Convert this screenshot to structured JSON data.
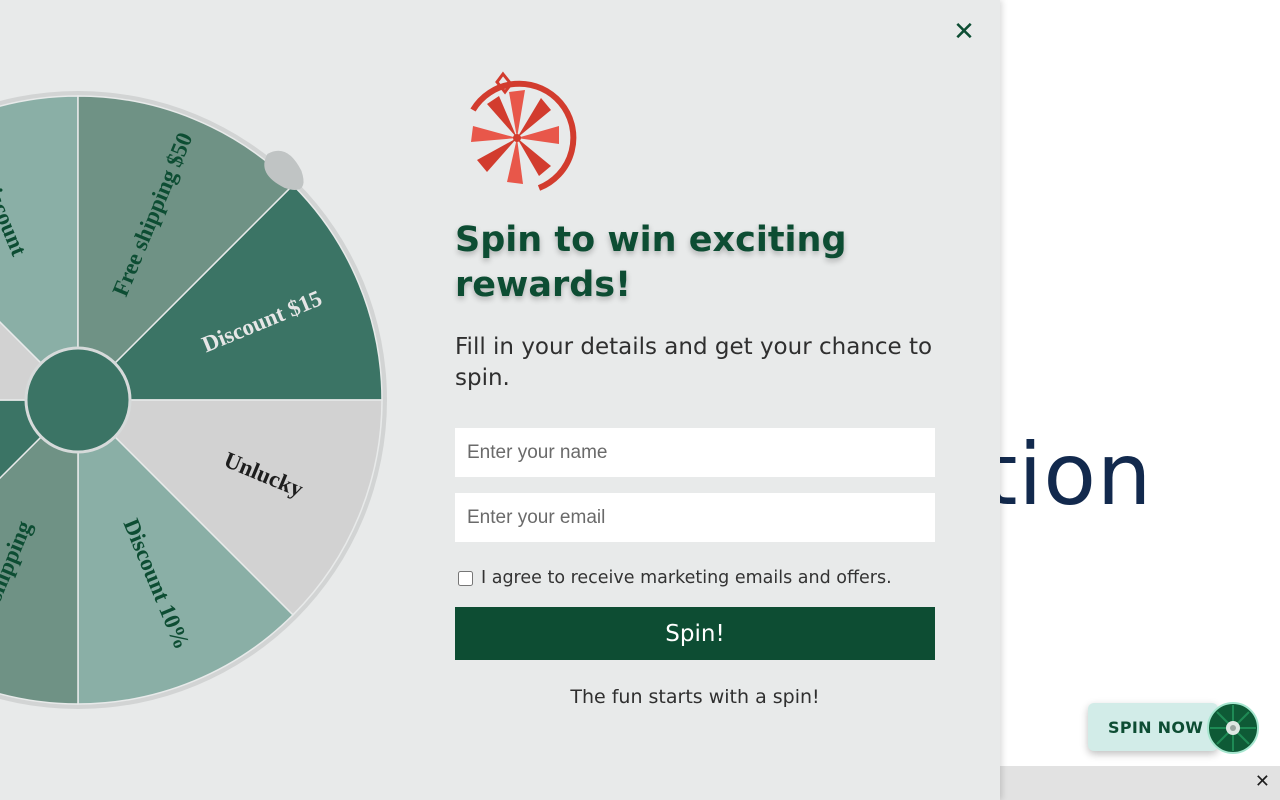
{
  "background": {
    "heading_fragment": "ation"
  },
  "popup": {
    "close_icon": "close-icon",
    "title": "Spin to win exciting rewards!",
    "subtitle": "Fill in your details and get your chance to spin.",
    "name_placeholder": "Enter your name",
    "email_placeholder": "Enter your email",
    "consent_label": "I agree to receive marketing emails and offers.",
    "consent_checked": false,
    "spin_button": "Spin!",
    "footer": "The fun starts with a spin!",
    "colors": {
      "brand_green": "#0d4d33",
      "logo_red": "#d23c2e",
      "panel_bg": "#e8eaea"
    }
  },
  "wheel": {
    "segments": [
      {
        "label": "Discount $15",
        "color": "#3b7465",
        "text_color": "#e6e6e6"
      },
      {
        "label": "Unlucky",
        "color": "#d2d2d2",
        "text_color": "#1e1e1e"
      },
      {
        "label": "Discount 10%",
        "color": "#8aafa6",
        "text_color": "#0d4d33"
      },
      {
        "label": "Free shipping",
        "color": "#6f9285",
        "text_color": "#0d4d33"
      },
      {
        "label": "",
        "color": "#3b7465",
        "text_color": "#e6e6e6"
      },
      {
        "label": "",
        "color": "#d2d2d2",
        "text_color": "#1e1e1e"
      },
      {
        "label": "Discount",
        "color": "#8aafa6",
        "text_color": "#0d4d33"
      },
      {
        "label": "Free shipping $50",
        "color": "#6f9285",
        "text_color": "#0d4d33"
      }
    ]
  },
  "floating_widget": {
    "label": "SPIN NOW"
  },
  "bottom_bar": {
    "close_icon": "close-icon"
  }
}
